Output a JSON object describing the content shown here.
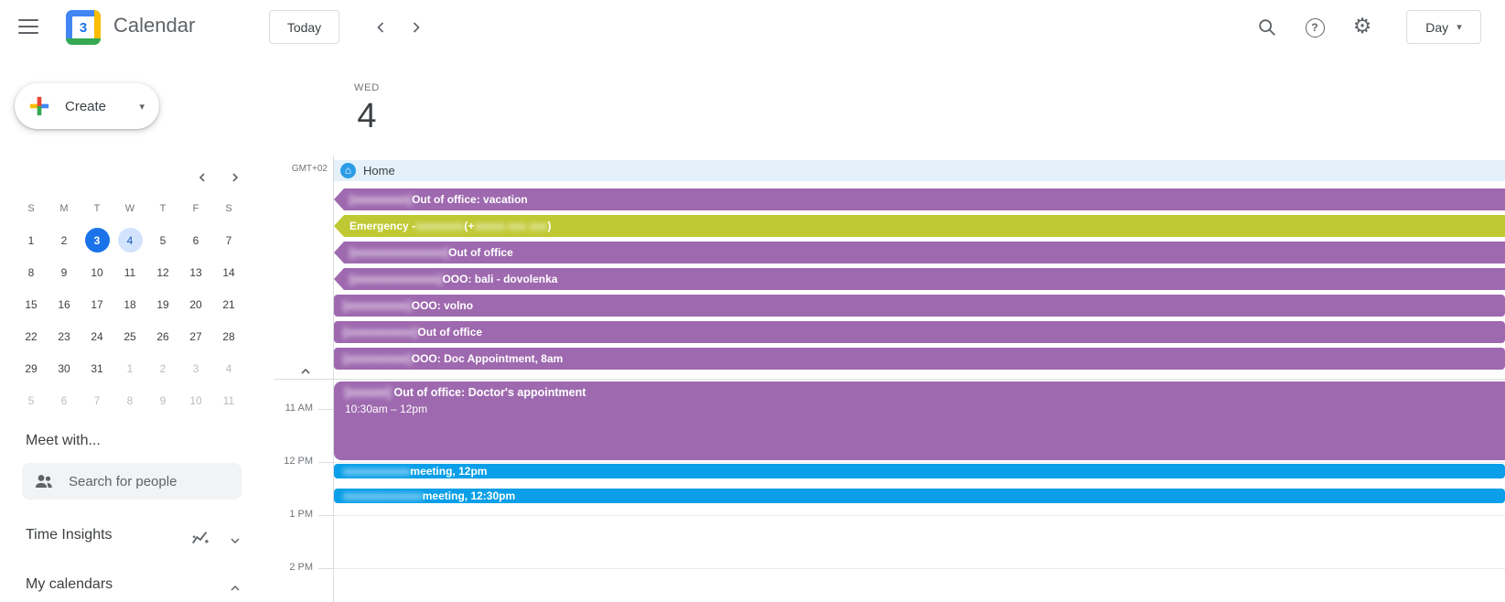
{
  "topbar": {
    "app_name": "Calendar",
    "logo_number": "3",
    "today_button": "Today",
    "view_selector": "Day"
  },
  "sidebar": {
    "create_label": "Create",
    "mini_calendar": {
      "weekdays": [
        "S",
        "M",
        "T",
        "W",
        "T",
        "F",
        "S"
      ],
      "weeks": [
        [
          {
            "d": "1"
          },
          {
            "d": "2"
          },
          {
            "d": "3",
            "mark": "today"
          },
          {
            "d": "4",
            "mark": "selected"
          },
          {
            "d": "5"
          },
          {
            "d": "6"
          },
          {
            "d": "7"
          }
        ],
        [
          {
            "d": "8"
          },
          {
            "d": "9"
          },
          {
            "d": "10"
          },
          {
            "d": "11"
          },
          {
            "d": "12"
          },
          {
            "d": "13"
          },
          {
            "d": "14"
          }
        ],
        [
          {
            "d": "15"
          },
          {
            "d": "16"
          },
          {
            "d": "17"
          },
          {
            "d": "18"
          },
          {
            "d": "19"
          },
          {
            "d": "20"
          },
          {
            "d": "21"
          }
        ],
        [
          {
            "d": "22"
          },
          {
            "d": "23"
          },
          {
            "d": "24"
          },
          {
            "d": "25"
          },
          {
            "d": "26"
          },
          {
            "d": "27"
          },
          {
            "d": "28"
          }
        ],
        [
          {
            "d": "29"
          },
          {
            "d": "30"
          },
          {
            "d": "31"
          },
          {
            "d": "1",
            "muted": true
          },
          {
            "d": "2",
            "muted": true
          },
          {
            "d": "3",
            "muted": true
          },
          {
            "d": "4",
            "muted": true
          }
        ],
        [
          {
            "d": "5",
            "muted": true
          },
          {
            "d": "6",
            "muted": true
          },
          {
            "d": "7",
            "muted": true
          },
          {
            "d": "8",
            "muted": true
          },
          {
            "d": "9",
            "muted": true
          },
          {
            "d": "10",
            "muted": true
          },
          {
            "d": "11",
            "muted": true
          }
        ]
      ]
    },
    "meet_with_label": "Meet with...",
    "search_people_placeholder": "Search for people",
    "time_insights_label": "Time Insights",
    "my_calendars_label": "My calendars"
  },
  "main": {
    "timezone": "GMT+02",
    "day": {
      "weekday": "WED",
      "number": "4"
    },
    "working_location": {
      "label": "Home"
    },
    "allday_events": [
      {
        "color": "purple",
        "continues_left": true,
        "segments": [
          {
            "text": "[xxxxxxxxx]",
            "redacted": true
          },
          {
            "text": " Out of office: vacation"
          }
        ]
      },
      {
        "color": "olive",
        "continues_left": true,
        "segments": [
          {
            "text": "Emergency - "
          },
          {
            "text": "xxxxxxxx",
            "redacted": true
          },
          {
            "text": " (+"
          },
          {
            "text": "xxxxx xxx xxx",
            "redacted": true
          },
          {
            "text": ")"
          }
        ]
      },
      {
        "color": "purple",
        "continues_left": true,
        "segments": [
          {
            "text": "[xxxxxxxxxxxxxxx]",
            "redacted": true
          },
          {
            "text": " Out of office"
          }
        ]
      },
      {
        "color": "purple",
        "continues_left": true,
        "segments": [
          {
            "text": "[xxxxxxxxxxxxxx]",
            "redacted": true
          },
          {
            "text": " OOO: bali - dovolenka"
          }
        ]
      },
      {
        "color": "purple",
        "continues_left": false,
        "segments": [
          {
            "text": "[xxxxxxxxxx]",
            "redacted": true
          },
          {
            "text": " OOO: volno"
          }
        ]
      },
      {
        "color": "purple",
        "continues_left": false,
        "segments": [
          {
            "text": "[xxxxxxxxxxx]",
            "redacted": true
          },
          {
            "text": " Out of office"
          }
        ]
      },
      {
        "color": "purple",
        "continues_left": false,
        "segments": [
          {
            "text": "[xxxxxxxxxx]",
            "redacted": true
          },
          {
            "text": " OOO: Doc Appointment, 8am"
          }
        ]
      }
    ],
    "timed_block": {
      "color": "purple",
      "segments": [
        {
          "text": "[xxxxxx]",
          "redacted": true
        },
        {
          "text": " Out of office: Doctor's appointment"
        }
      ],
      "time_range": "10:30am – 12pm"
    },
    "meetings": [
      {
        "color": "blue",
        "segments": [
          {
            "text": "xxxxxxxxxxx",
            "redacted": true
          },
          {
            "text": " meeting, 12pm"
          }
        ]
      },
      {
        "color": "blue",
        "segments": [
          {
            "text": "xxxxxxxxxxxxx",
            "redacted": true
          },
          {
            "text": " meeting, 12:30pm"
          }
        ]
      }
    ],
    "hour_labels": [
      "11 AM",
      "12 PM",
      "1 PM",
      "2 PM"
    ]
  },
  "colors": {
    "purple": "#9e69af",
    "olive": "#bfc933",
    "blue": "#0a9fe8",
    "accent_blue": "#1a73e8",
    "home_strip": "#e4f1fb"
  }
}
